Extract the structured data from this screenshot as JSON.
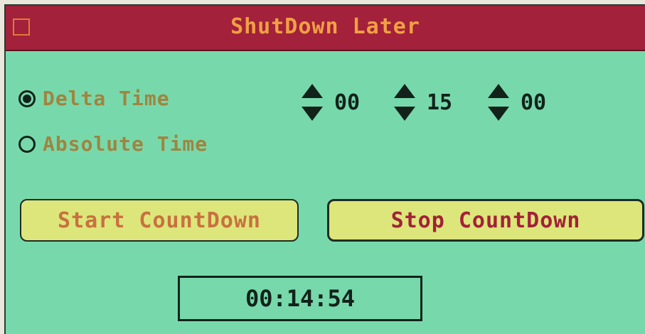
{
  "window": {
    "title": "ShutDown Later"
  },
  "mode": {
    "options": [
      {
        "label": "Delta Time",
        "selected": true
      },
      {
        "label": "Absolute Time",
        "selected": false
      }
    ]
  },
  "time": {
    "hours": "00",
    "minutes": "15",
    "seconds": "00"
  },
  "buttons": {
    "start_label": "Start CountDown",
    "stop_label": "Stop CountDown"
  },
  "countdown": {
    "display": "00:14:54"
  },
  "colors": {
    "window_bg": "#77d9ab",
    "titlebar": "#a3213a",
    "title_text": "#f0a044",
    "button_bg": "#dde67a"
  }
}
